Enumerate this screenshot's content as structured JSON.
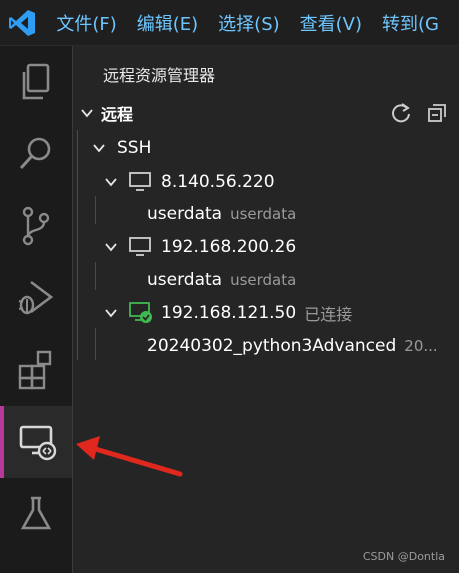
{
  "menubar": {
    "items": [
      "文件(F)",
      "编辑(E)",
      "选择(S)",
      "查看(V)",
      "转到(G"
    ]
  },
  "sidebar": {
    "title": "远程资源管理器",
    "section_title": "远程",
    "tree": {
      "root_label": "SSH",
      "hosts": [
        {
          "host": "8.140.56.220",
          "status": "",
          "child_label": "userdata",
          "child_desc": "userdata"
        },
        {
          "host": "192.168.200.26",
          "status": "",
          "child_label": "userdata",
          "child_desc": "userdata"
        },
        {
          "host": "192.168.121.50",
          "status": "已连接",
          "child_label": "20240302_python3Advanced",
          "child_desc": "20..."
        }
      ]
    }
  },
  "watermark": "CSDN @Dontla",
  "colors": {
    "menu_text": "#6ec6ff",
    "active_indicator": "#b5389a",
    "connected_green": "#3fb950",
    "arrow_red": "#e0281f"
  }
}
